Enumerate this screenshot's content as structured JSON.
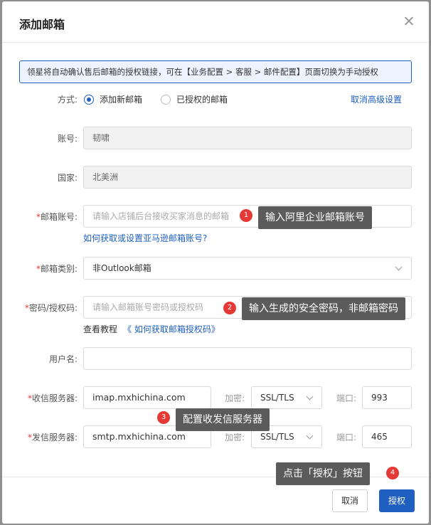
{
  "dialog": {
    "title": "添加邮箱",
    "close_icon": "close-icon"
  },
  "notice": "领星将自动确认售后邮箱的授权链接，可在【业务配置 > 客服 > 邮件配置】页面切换为手动授权",
  "form": {
    "mode": {
      "label": "方式:",
      "options": [
        "添加新邮箱",
        "已授权的邮箱"
      ],
      "selected": "添加新邮箱",
      "advanced_link": "取消高级设置"
    },
    "account": {
      "label": "账号:",
      "value": "韧啸"
    },
    "country": {
      "label": "国家:",
      "value": "北美洲"
    },
    "email_account": {
      "label": "邮箱账号:",
      "placeholder": "请输入店铺后台接收买家消息的邮箱",
      "help_link": "如何获取或设置亚马逊邮箱账号?"
    },
    "email_type": {
      "label": "邮箱类别:",
      "value": "非Outlook邮箱"
    },
    "password": {
      "label": "密码/授权码:",
      "placeholder": "请输入邮箱账号密码或授权码",
      "tutorial_prefix": "查看教程",
      "tutorial_link": "《 如何获取邮箱授权码》"
    },
    "username": {
      "label": "用户名:",
      "value": ""
    },
    "incoming": {
      "label": "收信服务器:",
      "server": "imap.mxhichina.com",
      "encrypt_label": "加密:",
      "encrypt": "SSL/TLS",
      "port_label": "端口:",
      "port": "993"
    },
    "outgoing": {
      "label": "发信服务器:",
      "server": "smtp.mxhichina.com",
      "encrypt_label": "加密:",
      "encrypt": "SSL/TLS",
      "port_label": "端口:",
      "port": "465"
    }
  },
  "footer": {
    "cancel": "取消",
    "submit": "授权"
  },
  "callouts": [
    {
      "num": "1",
      "text": "输入阿里企业邮箱账号"
    },
    {
      "num": "2",
      "text": "输入生成的安全密码，非邮箱密码"
    },
    {
      "num": "3",
      "text": "配置收发信服务器"
    },
    {
      "num": "4",
      "text": "点击「授权」按钮"
    }
  ]
}
